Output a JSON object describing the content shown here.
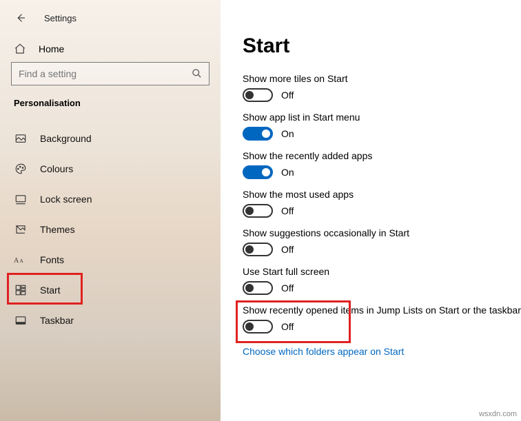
{
  "header": {
    "app_title": "Settings",
    "home_label": "Home",
    "search_placeholder": "Find a setting",
    "category": "Personalisation"
  },
  "sidebar": {
    "items": [
      {
        "label": "Background"
      },
      {
        "label": "Colours"
      },
      {
        "label": "Lock screen"
      },
      {
        "label": "Themes"
      },
      {
        "label": "Fonts"
      },
      {
        "label": "Start"
      },
      {
        "label": "Taskbar"
      }
    ]
  },
  "page": {
    "title": "Start"
  },
  "toggle_states": {
    "on": "On",
    "off": "Off"
  },
  "settings": [
    {
      "label": "Show more tiles on Start",
      "on": false
    },
    {
      "label": "Show app list in Start menu",
      "on": true
    },
    {
      "label": "Show the recently added apps",
      "on": true
    },
    {
      "label": "Show the most used apps",
      "on": false
    },
    {
      "label": "Show suggestions occasionally in Start",
      "on": false
    },
    {
      "label": "Use Start full screen",
      "on": false
    },
    {
      "label": "Show recently opened items in Jump Lists on Start or the taskbar",
      "on": false
    }
  ],
  "link": "Choose which folders appear on Start",
  "watermark": "wsxdn.com"
}
